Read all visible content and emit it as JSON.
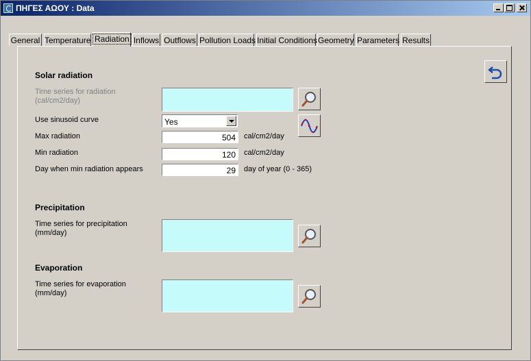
{
  "window": {
    "title": "ΠΗΓΕΣ ΑΩΟΥ : Data"
  },
  "tabs": [
    {
      "label": "General"
    },
    {
      "label": "Temperature"
    },
    {
      "label": "Radiation",
      "active": true
    },
    {
      "label": "Inflows"
    },
    {
      "label": "Outflows"
    },
    {
      "label": "Pollution Loads"
    },
    {
      "label": "Initial Conditions"
    },
    {
      "label": "Geometry"
    },
    {
      "label": "Parameters"
    },
    {
      "label": "Results"
    }
  ],
  "solar": {
    "heading": "Solar radiation",
    "ts_label_1": "Time series for radiation",
    "ts_label_2": "(cal/cm2/day)",
    "ts_value": "",
    "sin_label": "Use sinusoid curve",
    "sin_value": "Yes",
    "max_label": "Max radiation",
    "max_value": "504",
    "max_unit": "cal/cm2/day",
    "min_label": "Min radiation",
    "min_value": "120",
    "min_unit": "cal/cm2/day",
    "day_label": "Day when min radiation appears",
    "day_value": "29",
    "day_unit": "day of year (0 - 365)"
  },
  "precip": {
    "heading": "Precipitation",
    "ts_label_1": "Time series for precipitation",
    "ts_label_2": "(mm/day)",
    "ts_value": ""
  },
  "evap": {
    "heading": "Evaporation",
    "ts_label_1": "Time series for evaporation",
    "ts_label_2": "(mm/day)",
    "ts_value": ""
  },
  "icons": {
    "undo": "undo-arrow-icon",
    "browse": "magnifier-icon",
    "curve": "sine-curve-icon"
  },
  "colors": {
    "titlebar_start": "#0a246a",
    "titlebar_end": "#a6caf0",
    "timeseries_bg": "#c6fbfb",
    "face": "#d4d0c8"
  }
}
